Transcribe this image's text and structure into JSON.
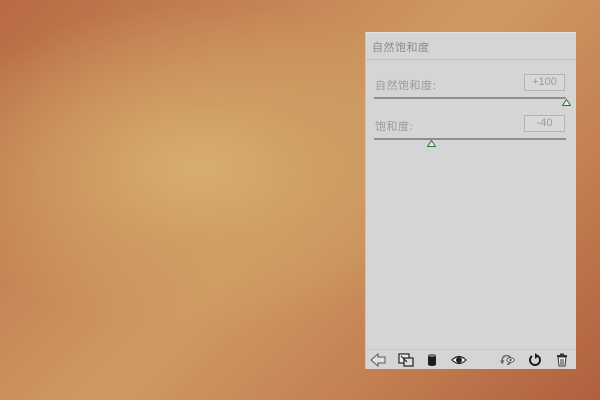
{
  "canvas": {
    "description_colors": {
      "center": "#d8b070",
      "edge": "#b0603f"
    }
  },
  "panel": {
    "title": "自然饱和度",
    "controls": [
      {
        "label": "自然饱和度:",
        "value": "+100",
        "fraction": 1.0
      },
      {
        "label": "饱和度:",
        "value": "-40",
        "fraction": 0.3
      }
    ],
    "footer_icons": [
      "clip-to-layer-icon",
      "view-previous-state-icon",
      "toggle-visibility-icon",
      "eye-icon",
      "undo-view-icon",
      "reset-icon",
      "trash-icon"
    ]
  },
  "colors": {
    "panel_bg": "#d5d5d5",
    "slider_thumb": "#2a8a3a",
    "label_text": "#9a9a9a"
  }
}
